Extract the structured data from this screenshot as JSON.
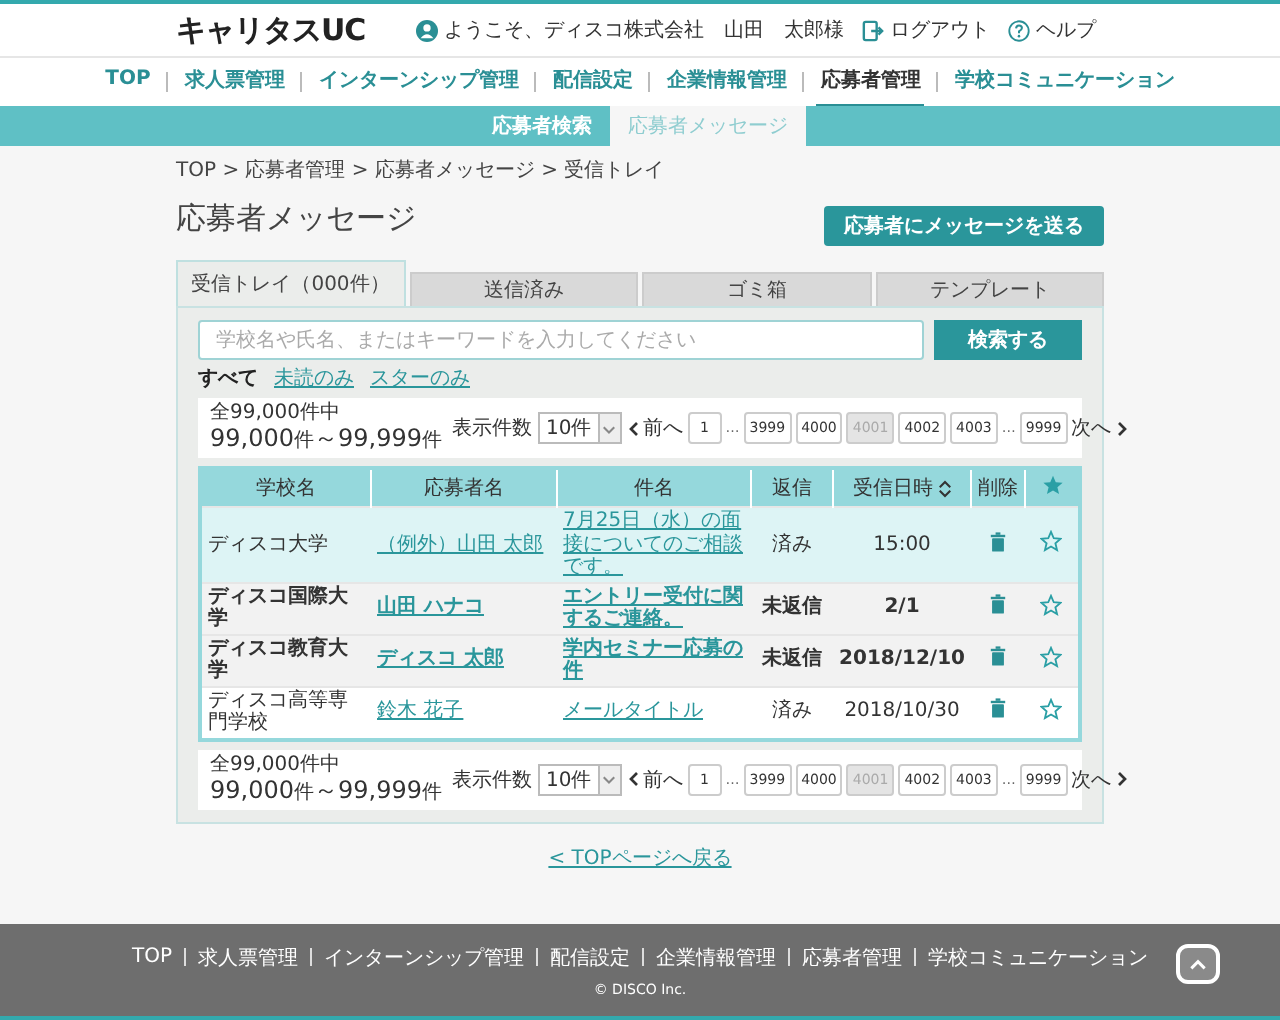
{
  "header": {
    "logo": "キャリタスUC",
    "welcome": "ようこそ、ディスコ株式会社　山田　太郎様",
    "logout": "ログアウト",
    "help": "ヘルプ"
  },
  "nav": [
    {
      "label": "TOP",
      "selected": false
    },
    {
      "label": "求人票管理",
      "selected": false
    },
    {
      "label": "インターンシップ管理",
      "selected": false
    },
    {
      "label": "配信設定",
      "selected": false
    },
    {
      "label": "企業情報管理",
      "selected": false
    },
    {
      "label": "応募者管理",
      "selected": true
    },
    {
      "label": "学校コミュニケーション",
      "selected": false
    }
  ],
  "subnav": [
    {
      "label": "応募者検索",
      "selected": false
    },
    {
      "label": "応募者メッセージ",
      "selected": true
    }
  ],
  "breadcrumb": "TOP > 応募者管理 > 応募者メッセージ > 受信トレイ",
  "title": "応募者メッセージ",
  "send_button": "応募者にメッセージを送る",
  "tabs": [
    {
      "label": "受信トレイ（000件）",
      "selected": true
    },
    {
      "label": "送信済み",
      "selected": false
    },
    {
      "label": "ゴミ箱",
      "selected": false
    },
    {
      "label": "テンプレート",
      "selected": false
    }
  ],
  "search": {
    "placeholder": "学校名や氏名、またはキーワードを入力してください",
    "button": "検索する"
  },
  "filters": [
    {
      "label": "すべて",
      "selected": true
    },
    {
      "label": "未読のみ",
      "selected": false
    },
    {
      "label": "スターのみ",
      "selected": false
    }
  ],
  "pagers": [
    {
      "total": "全99,000件中",
      "from": "99,000",
      "from_unit": "件",
      "sep": "～",
      "to": "99,999",
      "to_unit": "件",
      "per_page_label": "表示件数",
      "per_page": "10件",
      "prev": "前へ",
      "next": "次へ",
      "pages": [
        {
          "kind": "page",
          "label": "1",
          "selected": false
        },
        {
          "kind": "gap",
          "label": "…"
        },
        {
          "kind": "page",
          "label": "3999",
          "selected": false
        },
        {
          "kind": "page",
          "label": "4000",
          "selected": false
        },
        {
          "kind": "page",
          "label": "4001",
          "selected": true
        },
        {
          "kind": "page",
          "label": "4002",
          "selected": false
        },
        {
          "kind": "page",
          "label": "4003",
          "selected": false
        },
        {
          "kind": "gap",
          "label": "…"
        },
        {
          "kind": "page",
          "label": "9999",
          "selected": false
        }
      ]
    },
    {
      "total": "全99,000件中",
      "from": "99,000",
      "from_unit": "件",
      "sep": "～",
      "to": "99,999",
      "to_unit": "件",
      "per_page_label": "表示件数",
      "per_page": "10件",
      "prev": "前へ",
      "next": "次へ",
      "pages": [
        {
          "kind": "page",
          "label": "1",
          "selected": false
        },
        {
          "kind": "gap",
          "label": "…"
        },
        {
          "kind": "page",
          "label": "3999",
          "selected": false
        },
        {
          "kind": "page",
          "label": "4000",
          "selected": false
        },
        {
          "kind": "page",
          "label": "4001",
          "selected": true
        },
        {
          "kind": "page",
          "label": "4002",
          "selected": false
        },
        {
          "kind": "page",
          "label": "4003",
          "selected": false
        },
        {
          "kind": "gap",
          "label": "…"
        },
        {
          "kind": "page",
          "label": "9999",
          "selected": false
        }
      ]
    }
  ],
  "table": {
    "columns": [
      "学校名",
      "応募者名",
      "件名",
      "返信",
      "受信日時",
      "削除"
    ],
    "rows": [
      {
        "school": "ディスコ大学",
        "name": "（例外）山田 太郎",
        "subject": "7月25日（水）の面接についてのご相談です。",
        "reply": "済み",
        "date": "15:00",
        "unread": false,
        "selected": true,
        "starred": false
      },
      {
        "school": "ディスコ国際大学",
        "name": "山田 ハナコ",
        "subject": "エントリー受付に関するご連絡。",
        "reply": "未返信",
        "date": "2/1",
        "unread": true,
        "selected": false,
        "starred": false
      },
      {
        "school": "ディスコ教育大学",
        "name": "ディスコ 太郎",
        "subject": "学内セミナー応募の件",
        "reply": "未返信",
        "date": "2018/12/10",
        "unread": true,
        "selected": false,
        "starred": false
      },
      {
        "school": "ディスコ高等専門学校",
        "name": "鈴木 花子",
        "subject": "メールタイトル",
        "reply": "済み",
        "date": "2018/10/30",
        "unread": false,
        "selected": false,
        "starred": false
      }
    ]
  },
  "back_link": "< TOPページへ戻る",
  "footer": {
    "links": [
      "TOP",
      "求人票管理",
      "インターンシップ管理",
      "配信設定",
      "企業情報管理",
      "応募者管理",
      "学校コミュニケーション"
    ],
    "copyright": "© DISCO Inc."
  }
}
